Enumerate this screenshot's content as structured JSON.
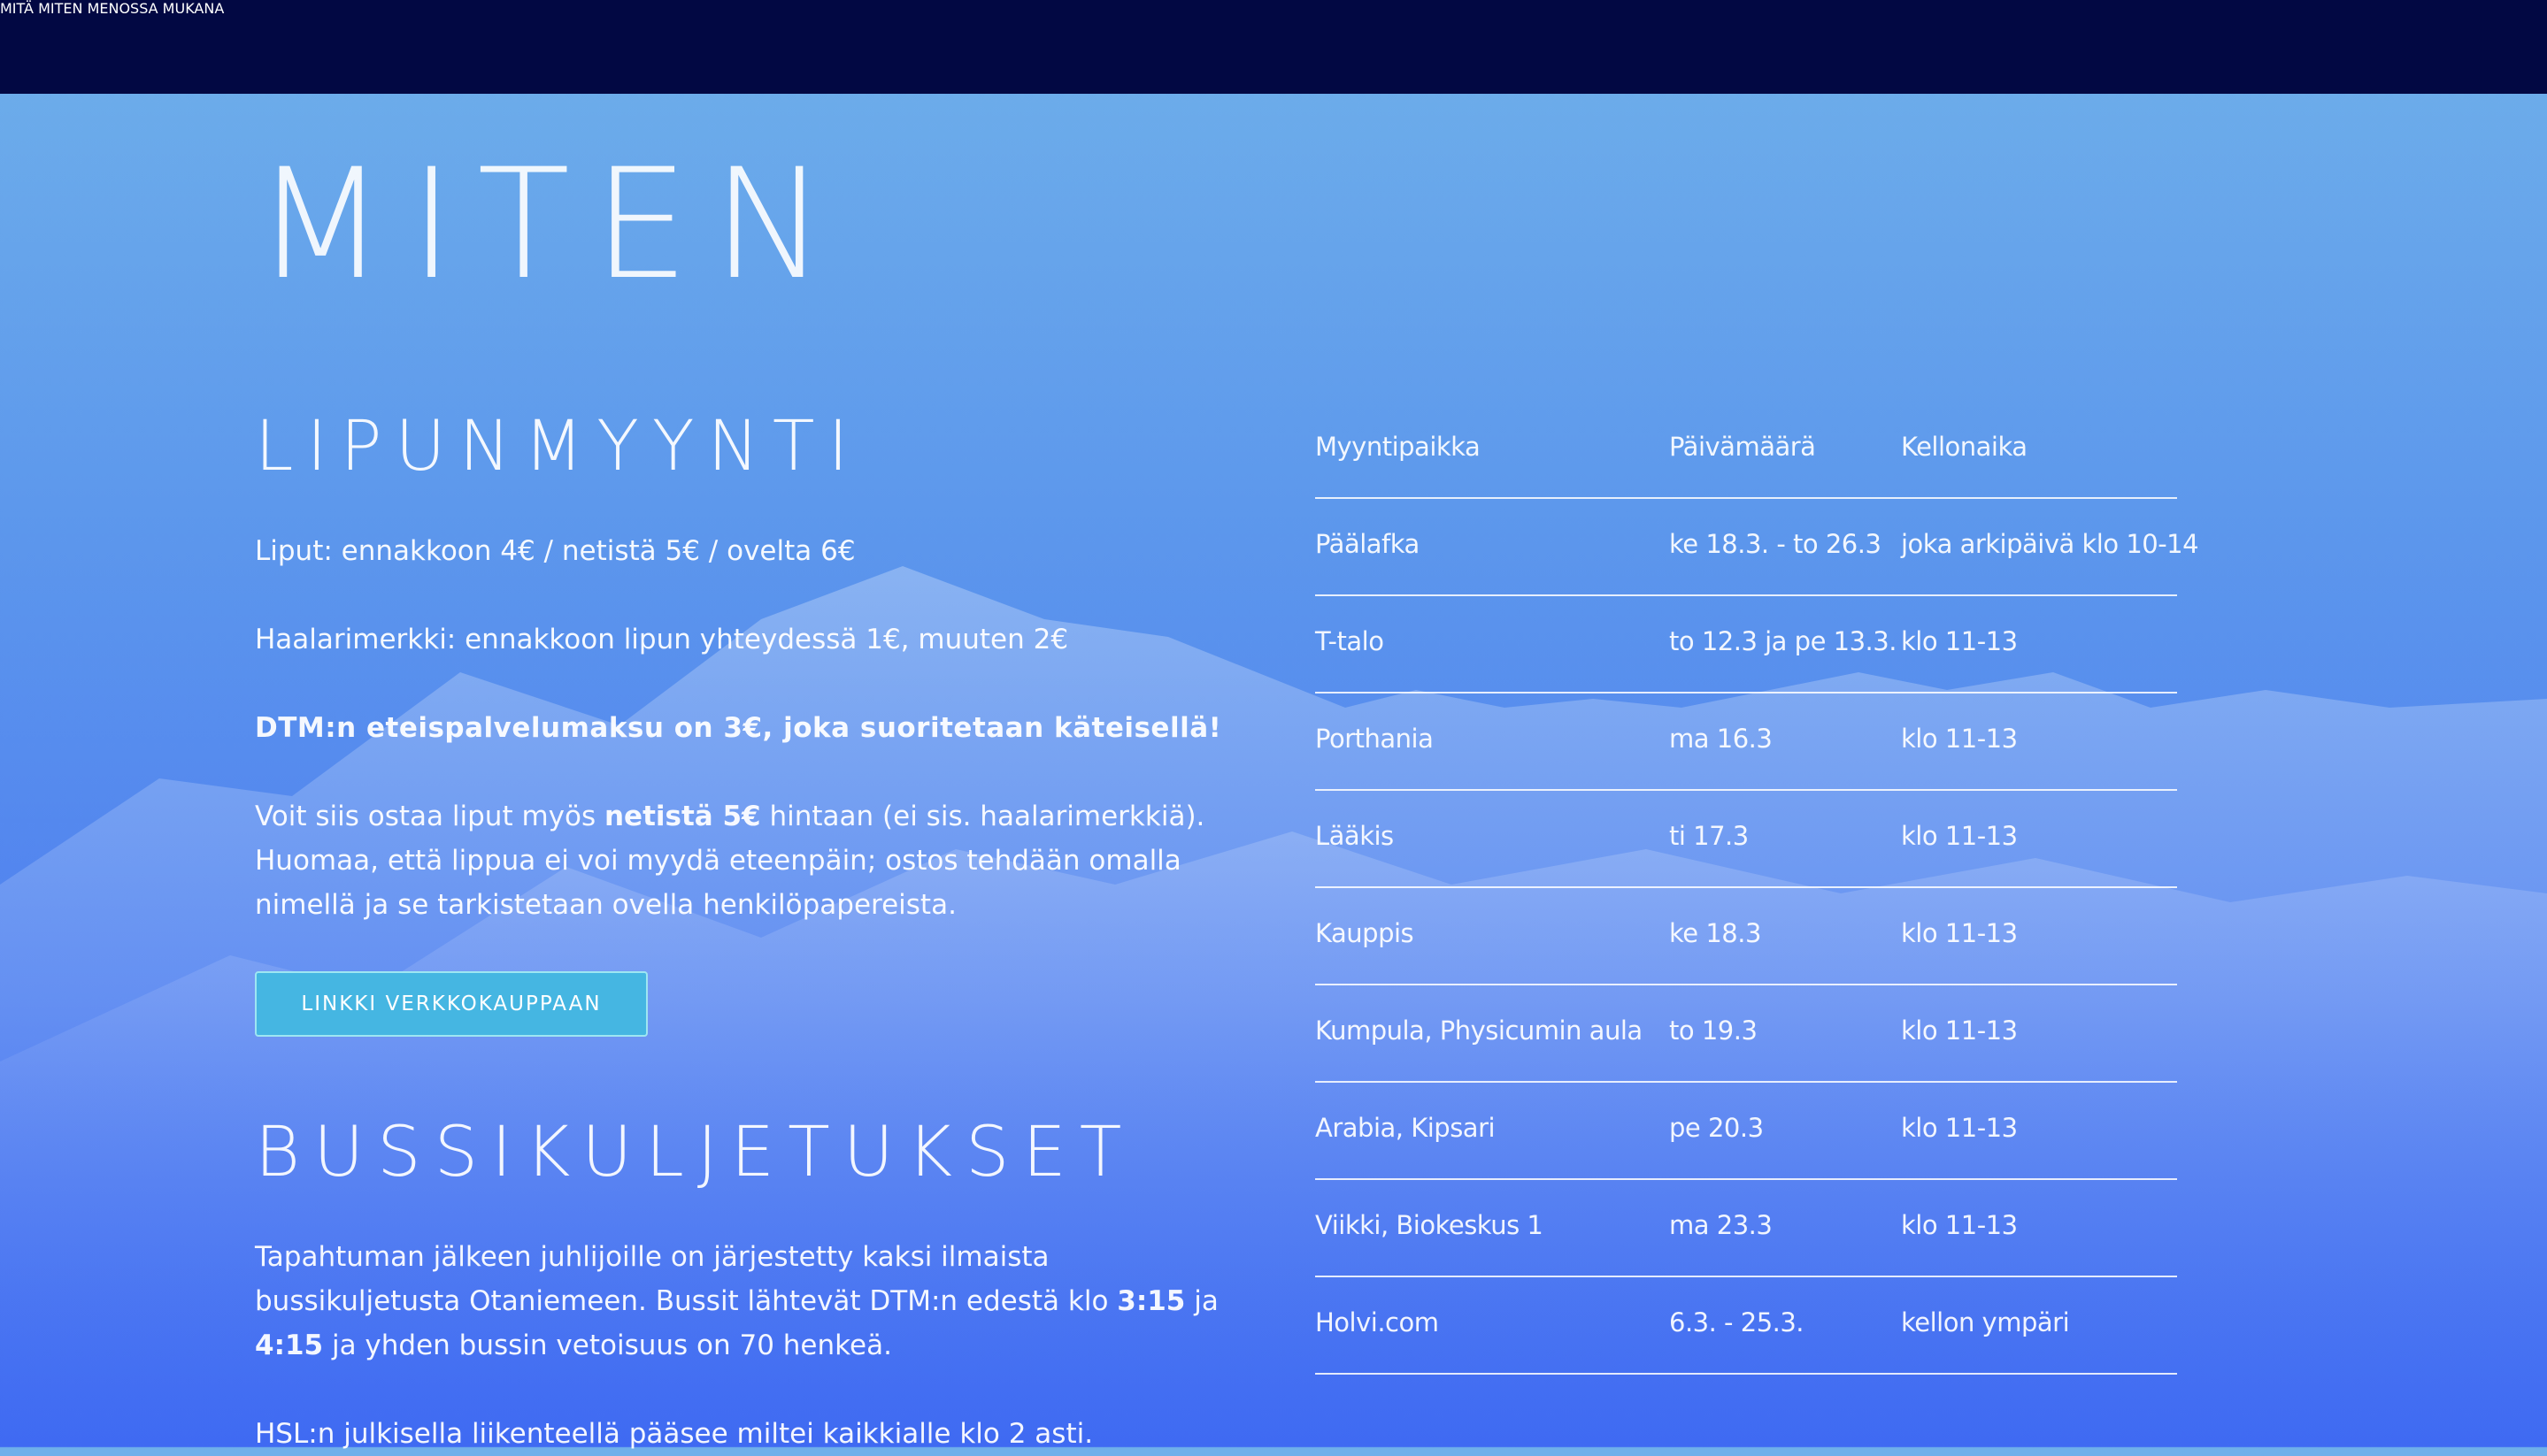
{
  "nav": {
    "items": [
      {
        "label": "MITÄ"
      },
      {
        "label": "MITEN"
      },
      {
        "label": "MENOSSA MUKANA"
      }
    ]
  },
  "colors": {
    "topbar": "#020843",
    "button": "#45b6e2",
    "background_top": "#6fb0ea",
    "background_bottom": "#3f6af2"
  },
  "page": {
    "title": "MITEN"
  },
  "ticket_section": {
    "title": "LIPUNMYYNTI",
    "prices": "Liput: ennakkoon 4€ / netistä 5€ / ovelta 6€",
    "badge": "Haalarimerkki: ennakkoon lipun yhteydessä 1€, muuten 2€",
    "fee": "DTM:n eteispalvelumaksu on 3€, joka suoritetaan käteisellä!",
    "online_before": "Voit siis ostaa liput myös ",
    "online_bold": "netistä 5€",
    "online_after": " hintaan (ei sis. haalarimerkkiä). Huomaa, että lippua ei voi myydä eteenpäin; ostos tehdään omalla nimellä ja se tarkistetaan ovella henkilöpapereista.",
    "shop_button": "LINKKI VERKKOKAUPPAAN"
  },
  "bus_section": {
    "title": "BUSSIKULJETUKSET",
    "text_before": "Tapahtuman jälkeen juhlijoille on järjestetty kaksi ilmaista bussikuljetusta Otaniemeen. Bussit lähtevät DTM:n edestä klo ",
    "time1": "3:15",
    "text_mid": " ja ",
    "time2": "4:15",
    "text_after": " ja yhden bussin vetoisuus on 70 henkeä.",
    "hsl": "HSL:n julkisella liikenteellä pääsee miltei kaikkialle klo 2 asti."
  },
  "sales_table": {
    "headers": [
      "Myyntipaikka",
      "Päivämäärä",
      "Kellonaika"
    ],
    "rows": [
      [
        "Päälafka",
        "ke 18.3. - to 26.3",
        "joka arkipäivä klo 10-14"
      ],
      [
        "T-talo",
        "to 12.3 ja pe 13.3.",
        "klo 11-13"
      ],
      [
        "Porthania",
        "ma 16.3",
        "klo 11-13"
      ],
      [
        "Lääkis",
        "ti 17.3",
        "klo 11-13"
      ],
      [
        "Kauppis",
        "ke 18.3",
        "klo 11-13"
      ],
      [
        "Kumpula, Physicumin aula",
        "to 19.3",
        "klo 11-13"
      ],
      [
        "Arabia, Kipsari",
        "pe 20.3",
        "klo 11-13"
      ],
      [
        "Viikki, Biokeskus 1",
        "ma 23.3",
        "klo 11-13"
      ],
      [
        "Holvi.com",
        "6.3. - 25.3.",
        "kellon ympäri"
      ]
    ]
  }
}
